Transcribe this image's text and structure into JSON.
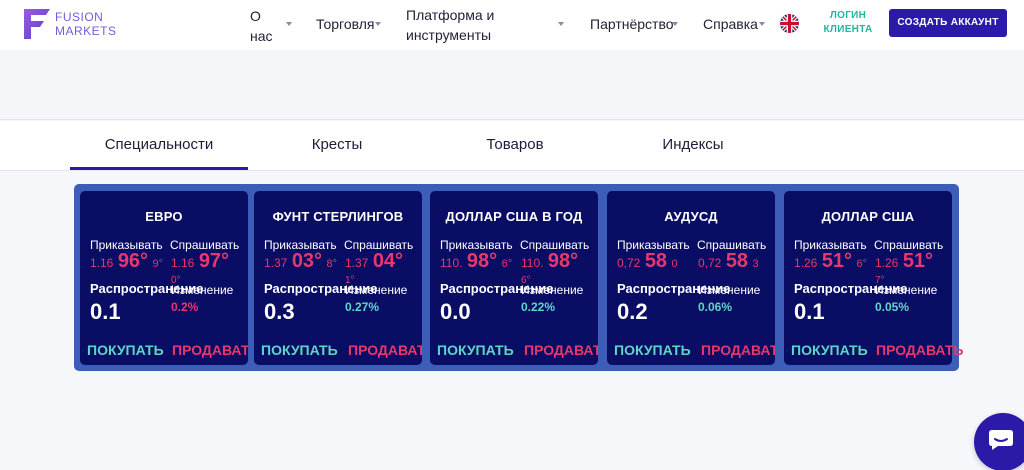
{
  "header": {
    "logo_line1": "FUSION",
    "logo_line2": "MARKETS",
    "nav": [
      {
        "label": "О\nнас"
      },
      {
        "label": "Торговля"
      },
      {
        "label": "Платформа и\nинструменты"
      },
      {
        "label": "Партнёрство"
      },
      {
        "label": "Справка"
      }
    ],
    "login": "ЛОГИН\nКЛИЕНТА",
    "create_account": "СОЗДАТЬ АККАУНТ"
  },
  "tabs": [
    "Специальности",
    "Кресты",
    "Товаров",
    "Индексы"
  ],
  "labels": {
    "bid": "Приказывать",
    "ask": "Спрашивать",
    "spread": "Распространение",
    "change": "Изменение",
    "buy": "ПОКУПАТЬ",
    "sell": "ПРОДАВАТЬ"
  },
  "cards": [
    {
      "title": "ЕВРО",
      "bid_small": "1.16",
      "bid_big": "96°",
      "bid_tiny": "9°",
      "ask_small": "1.16",
      "ask_big": "97°",
      "tiny_red": "0°",
      "spread": "0.1",
      "change": "0.2%",
      "change_color": "#e6386c"
    },
    {
      "title": "ФУНТ СТЕРЛИНГОВ",
      "bid_small": "1.37",
      "bid_big": "03°",
      "bid_tiny": "8°",
      "ask_small": "1.37",
      "ask_big": "04°",
      "tiny_red": "1°",
      "spread": "0.3",
      "change": "0.27%",
      "change_color": "#5ed6c7"
    },
    {
      "title": "ДОЛЛАР США В ГОД",
      "bid_small": "110.",
      "bid_big": "98°",
      "bid_tiny": "6°",
      "ask_small": "110.",
      "ask_big": "98°",
      "tiny_red": "6°",
      "spread": "0.0",
      "change": "0.22%",
      "change_color": "#5ed6c7"
    },
    {
      "title": "АУДУСД",
      "bid_small": "0,72",
      "bid_big": "58",
      "bid_tiny": "0",
      "ask_small": "0,72",
      "ask_big": "58",
      "ask_tiny": "3",
      "tiny_red": "",
      "spread": "0.2",
      "change": "0.06%",
      "change_color": "#5ed6c7"
    },
    {
      "title": "ДОЛЛАР США",
      "bid_small": "1.26",
      "bid_big": "51°",
      "bid_tiny": "6°",
      "ask_small": "1.26",
      "ask_big": "51°",
      "tiny_red": "7°",
      "spread": "0.1",
      "change": "0.05%",
      "change_color": "#5ed6c7"
    }
  ],
  "colors": {
    "brand": "#2b1aa7",
    "accent_teal": "#5ed6c7",
    "accent_red": "#e6386c",
    "card_bg": "#0a0d64",
    "wrap_bg": "#3c5db8"
  },
  "icons": {
    "logo": "fusion-logo-icon",
    "chat": "chat-icon",
    "flag": "uk-flag-icon"
  }
}
